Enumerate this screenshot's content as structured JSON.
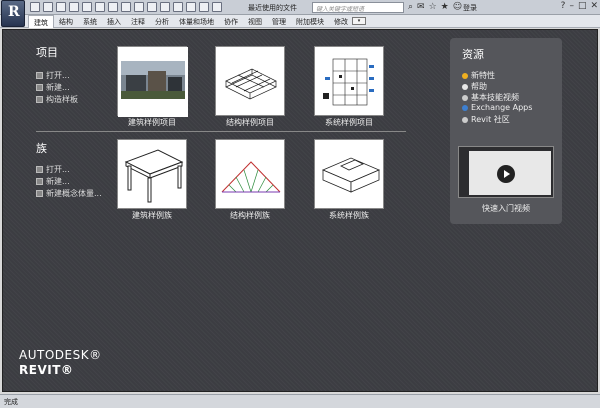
{
  "titlebar": {
    "app_letter": "R",
    "doc_title": "最近使用的文件",
    "search_placeholder": "键入关键字或短语",
    "login": "登录"
  },
  "ribbon": {
    "tabs": [
      "建筑",
      "结构",
      "系统",
      "插入",
      "注释",
      "分析",
      "体量和场地",
      "协作",
      "视图",
      "管理",
      "附加模块",
      "修改"
    ],
    "active_tab": "建筑"
  },
  "projects": {
    "title": "项目",
    "links": [
      "打开...",
      "新建...",
      "构造样板"
    ],
    "thumbs": [
      {
        "caption": "建筑样例项目"
      },
      {
        "caption": "结构样例项目"
      },
      {
        "caption": "系统样例项目"
      }
    ]
  },
  "families": {
    "title": "族",
    "links": [
      "打开...",
      "新建...",
      "新建概念体量..."
    ],
    "thumbs": [
      {
        "caption": "建筑样例族"
      },
      {
        "caption": "结构样例族"
      },
      {
        "caption": "系统样例族"
      }
    ]
  },
  "resources": {
    "title": "资源",
    "items": [
      {
        "label": "新特性",
        "color": "#f0b020"
      },
      {
        "label": "帮助",
        "color": "#e8e8e8"
      },
      {
        "label": "基本技能视频",
        "color": "#cccccc"
      },
      {
        "label": "Exchange Apps",
        "color": "#3d7fd0"
      },
      {
        "label": "Revit 社区",
        "color": "#cccccc"
      }
    ],
    "video_caption": "快速入门视频"
  },
  "branding": {
    "autodesk": "AUTODESK®",
    "revit": "REVIT®"
  },
  "status": {
    "text": "完成"
  }
}
